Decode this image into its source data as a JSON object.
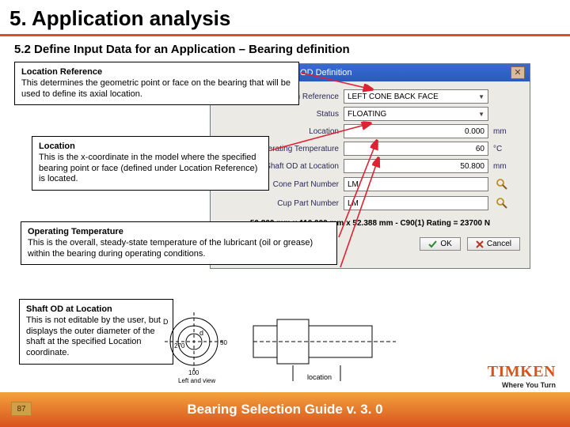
{
  "title": "5. Application analysis",
  "subtitle": "5.2 Define Input Data for an Application – Bearing definition",
  "callouts": {
    "locref": {
      "head": "Location Reference",
      "body": "This determines the geometric point or face on the bearing that will be used to define its axial location."
    },
    "location": {
      "head": "Location",
      "body": "This is the x-coordinate in the model where the specified bearing point or face (defined under Location Reference) is located."
    },
    "optemp": {
      "head": "Operating Temperature",
      "body": "This is the overall, steady-state temperature of the lubricant (oil or grease) within the bearing during operating conditions."
    },
    "shaftod": {
      "head": "Shaft OD at Location",
      "body": "This is not editable by the user, but displays the outer diameter of the shaft at the specified Location coordinate."
    }
  },
  "dialog": {
    "title": "Bearing Location and OD Definition",
    "close": "✕",
    "rows": {
      "locref": {
        "label": "Location Reference",
        "value": "LEFT CONE BACK FACE"
      },
      "status": {
        "label": "Status",
        "value": "FLOATING"
      },
      "location": {
        "label": "Location",
        "value": "0.000",
        "unit": "mm"
      },
      "optemp": {
        "label": "Operating Temperature",
        "value": "60",
        "unit": "°C"
      },
      "shaftod": {
        "label": "Shaft OD at Location",
        "value": "50.800",
        "unit": "mm"
      },
      "cone": {
        "label": "Cone Part Number",
        "value": "LM"
      },
      "cup": {
        "label": "Cup Part Number",
        "value": "LM"
      }
    },
    "summary": "50.800 mm x 110.000 mm x 52.388 mm - C90(1) Rating = 23700 N",
    "ok": "OK",
    "cancel": "Cancel"
  },
  "diagram": {
    "d1": "D",
    "d2": "d",
    "n270": "270",
    "n50": "50",
    "n100": "100",
    "leftview": "Left and view",
    "loc": "location"
  },
  "logo": {
    "name": "TIMKEN",
    "tag": "Where You Turn"
  },
  "footer": "Bearing Selection Guide v. 3. 0",
  "page": "87"
}
